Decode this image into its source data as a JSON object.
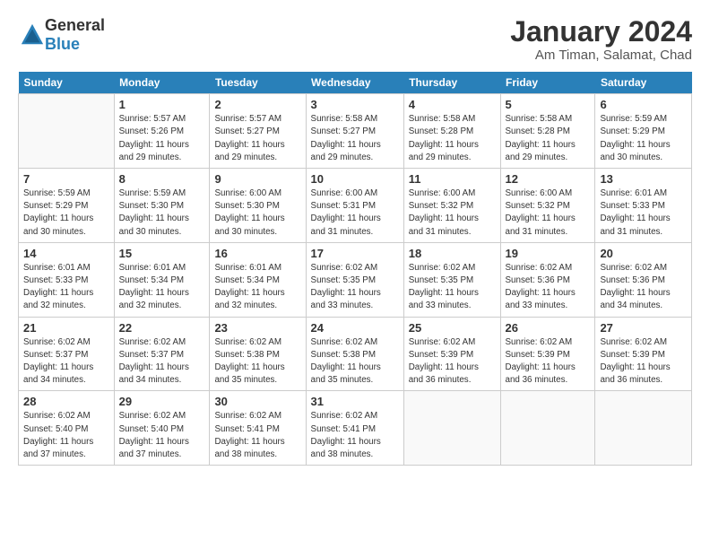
{
  "logo": {
    "text_general": "General",
    "text_blue": "Blue"
  },
  "title": "January 2024",
  "subtitle": "Am Timan, Salamat, Chad",
  "days_of_week": [
    "Sunday",
    "Monday",
    "Tuesday",
    "Wednesday",
    "Thursday",
    "Friday",
    "Saturday"
  ],
  "weeks": [
    [
      {
        "num": "",
        "info": ""
      },
      {
        "num": "1",
        "info": "Sunrise: 5:57 AM\nSunset: 5:26 PM\nDaylight: 11 hours\nand 29 minutes."
      },
      {
        "num": "2",
        "info": "Sunrise: 5:57 AM\nSunset: 5:27 PM\nDaylight: 11 hours\nand 29 minutes."
      },
      {
        "num": "3",
        "info": "Sunrise: 5:58 AM\nSunset: 5:27 PM\nDaylight: 11 hours\nand 29 minutes."
      },
      {
        "num": "4",
        "info": "Sunrise: 5:58 AM\nSunset: 5:28 PM\nDaylight: 11 hours\nand 29 minutes."
      },
      {
        "num": "5",
        "info": "Sunrise: 5:58 AM\nSunset: 5:28 PM\nDaylight: 11 hours\nand 29 minutes."
      },
      {
        "num": "6",
        "info": "Sunrise: 5:59 AM\nSunset: 5:29 PM\nDaylight: 11 hours\nand 30 minutes."
      }
    ],
    [
      {
        "num": "7",
        "info": "Sunrise: 5:59 AM\nSunset: 5:29 PM\nDaylight: 11 hours\nand 30 minutes."
      },
      {
        "num": "8",
        "info": "Sunrise: 5:59 AM\nSunset: 5:30 PM\nDaylight: 11 hours\nand 30 minutes."
      },
      {
        "num": "9",
        "info": "Sunrise: 6:00 AM\nSunset: 5:30 PM\nDaylight: 11 hours\nand 30 minutes."
      },
      {
        "num": "10",
        "info": "Sunrise: 6:00 AM\nSunset: 5:31 PM\nDaylight: 11 hours\nand 31 minutes."
      },
      {
        "num": "11",
        "info": "Sunrise: 6:00 AM\nSunset: 5:32 PM\nDaylight: 11 hours\nand 31 minutes."
      },
      {
        "num": "12",
        "info": "Sunrise: 6:00 AM\nSunset: 5:32 PM\nDaylight: 11 hours\nand 31 minutes."
      },
      {
        "num": "13",
        "info": "Sunrise: 6:01 AM\nSunset: 5:33 PM\nDaylight: 11 hours\nand 31 minutes."
      }
    ],
    [
      {
        "num": "14",
        "info": "Sunrise: 6:01 AM\nSunset: 5:33 PM\nDaylight: 11 hours\nand 32 minutes."
      },
      {
        "num": "15",
        "info": "Sunrise: 6:01 AM\nSunset: 5:34 PM\nDaylight: 11 hours\nand 32 minutes."
      },
      {
        "num": "16",
        "info": "Sunrise: 6:01 AM\nSunset: 5:34 PM\nDaylight: 11 hours\nand 32 minutes."
      },
      {
        "num": "17",
        "info": "Sunrise: 6:02 AM\nSunset: 5:35 PM\nDaylight: 11 hours\nand 33 minutes."
      },
      {
        "num": "18",
        "info": "Sunrise: 6:02 AM\nSunset: 5:35 PM\nDaylight: 11 hours\nand 33 minutes."
      },
      {
        "num": "19",
        "info": "Sunrise: 6:02 AM\nSunset: 5:36 PM\nDaylight: 11 hours\nand 33 minutes."
      },
      {
        "num": "20",
        "info": "Sunrise: 6:02 AM\nSunset: 5:36 PM\nDaylight: 11 hours\nand 34 minutes."
      }
    ],
    [
      {
        "num": "21",
        "info": "Sunrise: 6:02 AM\nSunset: 5:37 PM\nDaylight: 11 hours\nand 34 minutes."
      },
      {
        "num": "22",
        "info": "Sunrise: 6:02 AM\nSunset: 5:37 PM\nDaylight: 11 hours\nand 34 minutes."
      },
      {
        "num": "23",
        "info": "Sunrise: 6:02 AM\nSunset: 5:38 PM\nDaylight: 11 hours\nand 35 minutes."
      },
      {
        "num": "24",
        "info": "Sunrise: 6:02 AM\nSunset: 5:38 PM\nDaylight: 11 hours\nand 35 minutes."
      },
      {
        "num": "25",
        "info": "Sunrise: 6:02 AM\nSunset: 5:39 PM\nDaylight: 11 hours\nand 36 minutes."
      },
      {
        "num": "26",
        "info": "Sunrise: 6:02 AM\nSunset: 5:39 PM\nDaylight: 11 hours\nand 36 minutes."
      },
      {
        "num": "27",
        "info": "Sunrise: 6:02 AM\nSunset: 5:39 PM\nDaylight: 11 hours\nand 36 minutes."
      }
    ],
    [
      {
        "num": "28",
        "info": "Sunrise: 6:02 AM\nSunset: 5:40 PM\nDaylight: 11 hours\nand 37 minutes."
      },
      {
        "num": "29",
        "info": "Sunrise: 6:02 AM\nSunset: 5:40 PM\nDaylight: 11 hours\nand 37 minutes."
      },
      {
        "num": "30",
        "info": "Sunrise: 6:02 AM\nSunset: 5:41 PM\nDaylight: 11 hours\nand 38 minutes."
      },
      {
        "num": "31",
        "info": "Sunrise: 6:02 AM\nSunset: 5:41 PM\nDaylight: 11 hours\nand 38 minutes."
      },
      {
        "num": "",
        "info": ""
      },
      {
        "num": "",
        "info": ""
      },
      {
        "num": "",
        "info": ""
      }
    ]
  ]
}
